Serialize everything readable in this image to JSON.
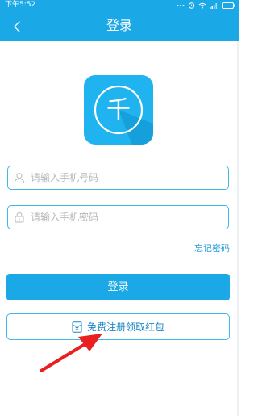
{
  "status_bar": {
    "time": "下午5:52",
    "icons": [
      "more-icon",
      "alarm-icon",
      "wifi-icon",
      "signal-icon",
      "battery-icon"
    ]
  },
  "nav": {
    "title": "登录",
    "back_icon": "chevron-left-icon"
  },
  "logo": {
    "char": "千",
    "color": "#1fb3f0"
  },
  "form": {
    "phone_placeholder": "请输入手机号码",
    "password_placeholder": "请输入手机密码",
    "forgot_label": "忘记密码",
    "login_label": "登录",
    "register_label": "免费注册领取红包"
  },
  "colors": {
    "accent": "#1ba8e6",
    "annotation_arrow": "#e8201f"
  }
}
